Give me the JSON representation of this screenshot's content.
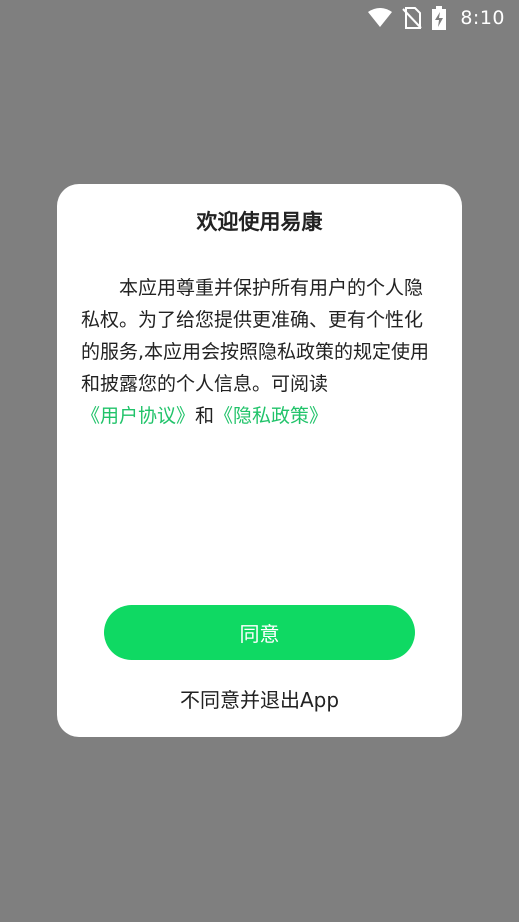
{
  "status_bar": {
    "time": "8:10",
    "icons": [
      "wifi-icon",
      "no-sim-icon",
      "battery-charging-icon"
    ]
  },
  "dialog": {
    "title": "欢迎使用易康",
    "body_text": "本应用尊重并保护所有用户的个人隐私权。为了给您提供更准确、更有个性化的服务,本应用会按照隐私政策的规定使用和披露您的个人信息。可阅读",
    "user_agreement_link": "《用户协议》",
    "and_text": "和",
    "privacy_policy_link": "《隐私政策》",
    "agree_label": "同意",
    "disagree_label": "不同意并退出App"
  },
  "colors": {
    "overlay": "#7f7f7f",
    "dialog_bg": "#ffffff",
    "accent": "#0fd963",
    "link": "#21c36a"
  }
}
